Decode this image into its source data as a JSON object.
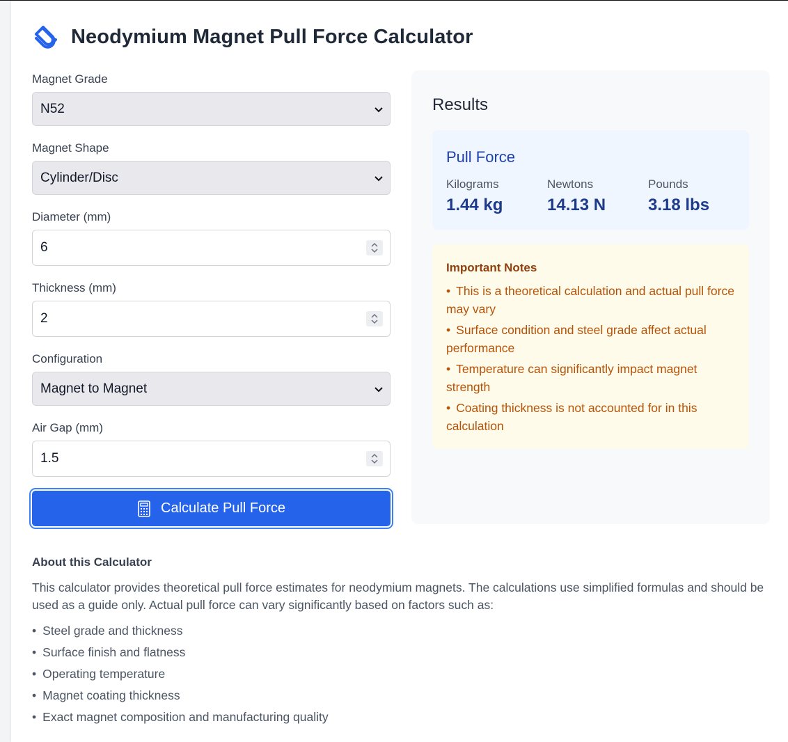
{
  "title": "Neodymium Magnet Pull Force Calculator",
  "icons": {
    "logo": "magnet-icon",
    "button": "calculator-icon"
  },
  "colors": {
    "primary": "#2563eb",
    "results_bg": "#eff6ff",
    "notes_bg": "#fefbea",
    "notes_text": "#b45309"
  },
  "form": {
    "grade": {
      "label": "Magnet Grade",
      "value": "N52"
    },
    "shape": {
      "label": "Magnet Shape",
      "value": "Cylinder/Disc"
    },
    "diameter": {
      "label": "Diameter (mm)",
      "value": "6"
    },
    "thickness": {
      "label": "Thickness (mm)",
      "value": "2"
    },
    "configuration": {
      "label": "Configuration",
      "value": "Magnet to Magnet"
    },
    "air_gap": {
      "label": "Air Gap (mm)",
      "value": "1.5"
    },
    "button_label": "Calculate Pull Force"
  },
  "results": {
    "heading": "Results",
    "pull_force": {
      "title": "Pull Force",
      "kg_label": "Kilograms",
      "kg_value": "1.44 kg",
      "n_label": "Newtons",
      "n_value": "14.13 N",
      "lb_label": "Pounds",
      "lb_value": "3.18 lbs"
    },
    "notes": {
      "title": "Important Notes",
      "items": [
        "This is a theoretical calculation and actual pull force may vary",
        "Surface condition and steel grade affect actual performance",
        "Temperature can significantly impact magnet strength",
        "Coating thickness is not accounted for in this calculation"
      ]
    }
  },
  "about": {
    "title": "About this Calculator",
    "text": "This calculator provides theoretical pull force estimates for neodymium magnets. The calculations use simplified formulas and should be used as a guide only. Actual pull force can vary significantly based on factors such as:",
    "items": [
      "Steel grade and thickness",
      "Surface finish and flatness",
      "Operating temperature",
      "Magnet coating thickness",
      "Exact magnet composition and manufacturing quality"
    ]
  }
}
